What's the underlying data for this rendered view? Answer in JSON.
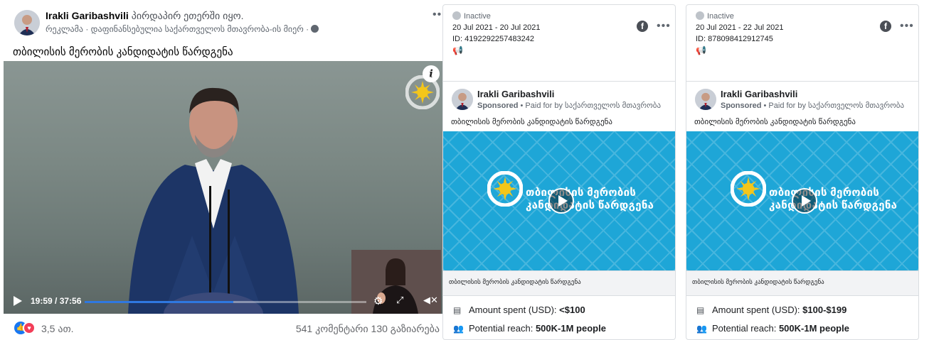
{
  "post": {
    "author": "Irakli Garibashvili",
    "live_text": "პირდაპირ ეთერში იყო.",
    "sponsored_line": "რეკლამა · დაფინანსებულია საქართველოს მთავრობა-ის მიერ ·",
    "caption": "თბილისის მერობის კანდიდატის წარდგენა",
    "video": {
      "time_display": "19:59 / 37:56",
      "progress_fraction": 0.527
    },
    "reactions_count": "3,5 ათ.",
    "comments_shares": "541 კომენტარი 130 გაზიარება"
  },
  "ads": [
    {
      "status": "Inactive",
      "dates": "20 Jul 2021 - 20 Jul 2021",
      "id_label": "ID: 4192292257483242",
      "page_name": "Irakli Garibashvili",
      "sponsored": "Sponsored",
      "paid_for": "• Paid for by საქართველოს მთავრობა",
      "ad_text": "თბილისის მერობის კანდიდატის წარდგენა",
      "video_title_line1": "თბილისის მერობის",
      "video_title_line2": "კანდიდატის წარდგენა",
      "link_caption": "თბილისის მერობის კანდიდატის წარდგენა",
      "amount_label": "Amount spent (USD): ",
      "amount_value": "<$100",
      "reach_label": "Potential reach: ",
      "reach_value": "500K-1M people"
    },
    {
      "status": "Inactive",
      "dates": "20 Jul 2021 - 22 Jul 2021",
      "id_label": "ID: 878098412912745",
      "page_name": "Irakli Garibashvili",
      "sponsored": "Sponsored",
      "paid_for": "• Paid for by საქართველოს მთავრობა",
      "ad_text": "თბილისის მერობის კანდიდატის წარდგენა",
      "video_title_line1": "თბილისის მერობის",
      "video_title_line2": "კანდიდატის წარდგენა",
      "link_caption": "თბილისის მერობის კანდიდატის წარდგენა",
      "amount_label": "Amount spent (USD): ",
      "amount_value": "$100-$199",
      "reach_label": "Potential reach: ",
      "reach_value": "500K-1M people"
    }
  ],
  "icons": {
    "more": "more-dots-icon",
    "facebook": "facebook-icon",
    "status": "inactive-status-icon",
    "megaphone": "megaphone-icon",
    "amount": "receipt-icon",
    "reach": "people-icon",
    "like": "like-reaction-icon",
    "love": "love-reaction-icon"
  },
  "colors": {
    "facebook_blue": "#1877f2",
    "progress_blue": "#2f78e0",
    "ad_video_bg": "#1ea6d7",
    "gd_yellow": "#f4c61a"
  }
}
